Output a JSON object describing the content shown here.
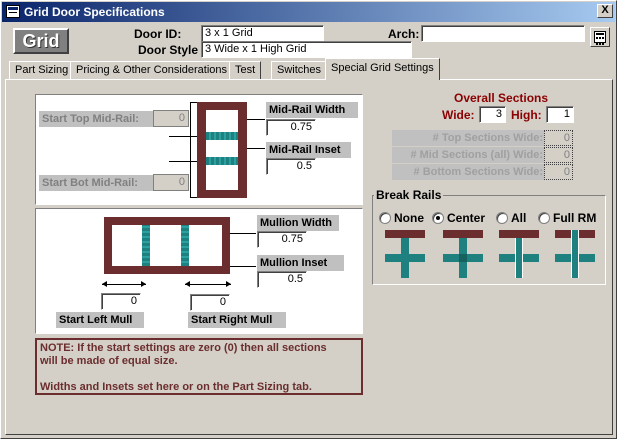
{
  "window": {
    "title": "Grid Door Specifications",
    "close_label": "X"
  },
  "logo": {
    "text": "Grid"
  },
  "header": {
    "door_id_label": "Door ID:",
    "door_id_value": "3 x 1 Grid",
    "door_style_label": "Door Style",
    "door_style_value": "3 Wide x 1 High Grid",
    "arch_label": "Arch:",
    "arch_value": ""
  },
  "tabs": [
    {
      "label": "Part Sizing",
      "active": false
    },
    {
      "label": "Pricing & Other Considerations",
      "active": false
    },
    {
      "label": "Test",
      "active": false
    },
    {
      "label": "Switches",
      "active": false
    },
    {
      "label": "Special Grid Settings",
      "active": true
    }
  ],
  "midrail": {
    "start_top_label": "Start Top Mid-Rail:",
    "start_top_value": "0",
    "start_bot_label": "Start Bot Mid-Rail:",
    "start_bot_value": "0",
    "width_label": "Mid-Rail Width",
    "width_value": "0.75",
    "inset_label": "Mid-Rail Inset",
    "inset_value": "0.5"
  },
  "mullion": {
    "width_label": "Mullion Width",
    "width_value": "0.75",
    "inset_label": "Mullion Inset",
    "inset_value": "0.5",
    "start_left_label": "Start Left Mull",
    "start_left_value": "0",
    "start_right_label": "Start Right Mull",
    "start_right_value": "0"
  },
  "overall": {
    "title": "Overall Sections",
    "wide_label": "Wide:",
    "wide_value": "3",
    "high_label": "High:",
    "high_value": "1",
    "top_wide_label": "# Top Sections Wide:",
    "top_wide_value": "0",
    "mid_wide_label": "# Mid Sections (all) Wide:",
    "mid_wide_value": "0",
    "bottom_wide_label": "# Bottom Sections Wide:",
    "bottom_wide_value": "0"
  },
  "break_rails": {
    "title": "Break Rails",
    "options": [
      {
        "label": "None",
        "selected": false
      },
      {
        "label": "Center",
        "selected": true
      },
      {
        "label": "All",
        "selected": false
      },
      {
        "label": "Full RM",
        "selected": false
      }
    ]
  },
  "note": {
    "line1": "NOTE: If the start settings are zero (0) then all sections",
    "line2": "will be made of equal size.",
    "line3": "Widths and Insets set here or on the Part Sizing tab."
  },
  "colors": {
    "frame": "#6b2d2d",
    "panel": "#1f8080",
    "title_bar": "#0a246a",
    "accent_text": "#8b0000"
  }
}
